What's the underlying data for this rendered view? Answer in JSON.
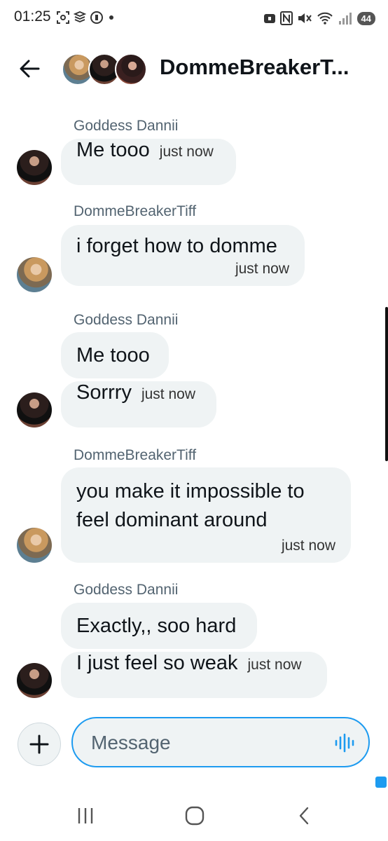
{
  "status_bar": {
    "time": "01:25",
    "battery": "44",
    "left_icons": [
      "screenshot-icon",
      "gallery-icon",
      "media-icon",
      "dot-icon"
    ],
    "right_icons": [
      "lock-badge-icon",
      "nfc-icon",
      "mute-icon",
      "wifi-icon",
      "signal-icon"
    ]
  },
  "header": {
    "title": "DommeBreakerT...",
    "back_icon": "arrow-left-icon",
    "avatars": [
      "avatar-tiff",
      "avatar-dannii",
      "avatar-third"
    ]
  },
  "messages": [
    {
      "sender": "Goddess Dannii",
      "bubbles": [
        {
          "text": "Me tooo",
          "time": "just now"
        }
      ]
    },
    {
      "sender": "DommeBreakerTiff",
      "bubbles": [
        {
          "text": "i forget how to domme",
          "time": "just now"
        }
      ]
    },
    {
      "sender": "Goddess Dannii",
      "bubbles": [
        {
          "text": "Me tooo"
        },
        {
          "text": "Sorrry",
          "time": "just now"
        }
      ]
    },
    {
      "sender": "DommeBreakerTiff",
      "bubbles": [
        {
          "text": "you make it impossible to feel dominant around",
          "time": "just now"
        }
      ]
    },
    {
      "sender": "Goddess Dannii",
      "bubbles": [
        {
          "text": "Exactly,, soo hard"
        },
        {
          "text": "I just feel so weak",
          "time": "just now"
        }
      ]
    }
  ],
  "composer": {
    "placeholder": "Message",
    "value": "",
    "add_icon": "plus-icon",
    "voice_icon": "voice-wave-icon"
  },
  "nav_bar": {
    "icons": [
      "recents-icon",
      "home-icon",
      "back-icon"
    ]
  },
  "colors": {
    "accent": "#1d9bf0",
    "bubble_bg": "#eff3f4",
    "secondary_text": "#536471",
    "text": "#0f1419"
  }
}
